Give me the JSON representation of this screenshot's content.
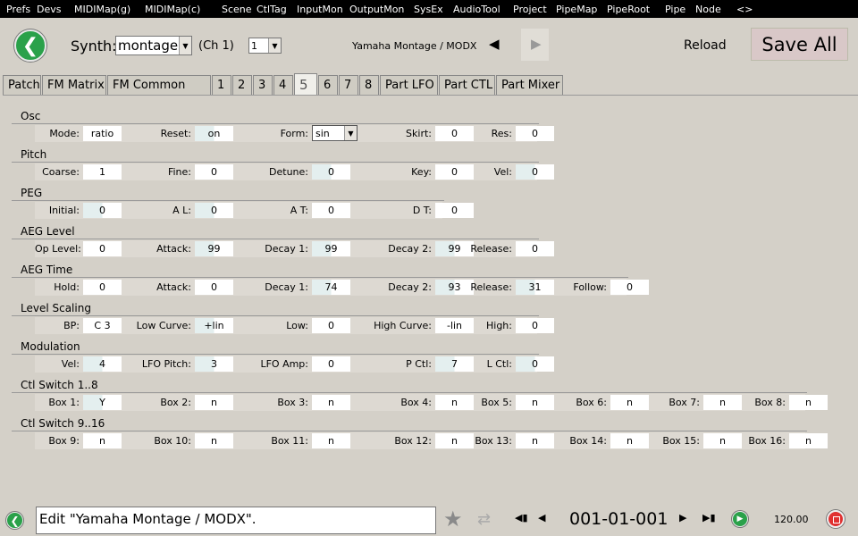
{
  "menu": [
    "Prefs",
    "Devs",
    "MIDIMap(g)",
    "MIDIMap(c)",
    "Scene",
    "CtlTag",
    "InputMon",
    "OutputMon",
    "SysEx",
    "AudioTool",
    "Project",
    "PipeMap",
    "PipeRoot",
    "Pipe",
    "Node",
    "<>"
  ],
  "header": {
    "synth_label": "Synth:",
    "synth_value": "montage",
    "ch_label": "(Ch 1)",
    "ch_value": "1",
    "device_title": "Yamaha Montage / MODX",
    "reload": "Reload",
    "save_all": "Save All"
  },
  "tabs": [
    {
      "label": "Patch",
      "active": false
    },
    {
      "label": "FM Matrix",
      "active": false
    },
    {
      "label": "FM Common",
      "active": false
    },
    {
      "label": "1",
      "active": false
    },
    {
      "label": "2",
      "active": false
    },
    {
      "label": "3",
      "active": false
    },
    {
      "label": "4",
      "active": false
    },
    {
      "label": "5",
      "active": true
    },
    {
      "label": "6",
      "active": false
    },
    {
      "label": "7",
      "active": false
    },
    {
      "label": "8",
      "active": false
    },
    {
      "label": "Part LFO",
      "active": false
    },
    {
      "label": "Part CTL",
      "active": false
    },
    {
      "label": "Part Mixer",
      "active": false
    }
  ],
  "sections": [
    {
      "title": "Osc",
      "fields": [
        {
          "label": "Mode:",
          "value": "ratio"
        },
        {
          "label": "Reset:",
          "value": "on",
          "style": "teal"
        },
        {
          "label": "Form:",
          "value": "sin",
          "type": "select"
        },
        {
          "label": "Skirt:",
          "value": "0"
        },
        {
          "label": "Res:",
          "value": "0"
        }
      ]
    },
    {
      "title": "Pitch",
      "fields": [
        {
          "label": "Coarse:",
          "value": "1"
        },
        {
          "label": "Fine:",
          "value": "0"
        },
        {
          "label": "Detune:",
          "value": "0",
          "style": "teal"
        },
        {
          "label": "Key:",
          "value": "0"
        },
        {
          "label": "Vel:",
          "value": "0",
          "style": "teal"
        }
      ]
    },
    {
      "title": "PEG",
      "fields": [
        {
          "label": "Initial:",
          "value": "0",
          "style": "teal"
        },
        {
          "label": "A L:",
          "value": "0",
          "style": "teal"
        },
        {
          "label": "A T:",
          "value": "0"
        },
        {
          "label": "D T:",
          "value": "0"
        }
      ]
    },
    {
      "title": "AEG Level",
      "fields": [
        {
          "label": "Op Level:",
          "value": "0"
        },
        {
          "label": "Attack:",
          "value": "99",
          "style": "teal"
        },
        {
          "label": "Decay 1:",
          "value": "99",
          "style": "teal"
        },
        {
          "label": "Decay 2:",
          "value": "99",
          "style": "teal"
        },
        {
          "label": "Release:",
          "value": "0"
        }
      ]
    },
    {
      "title": "AEG Time",
      "fields": [
        {
          "label": "Hold:",
          "value": "0"
        },
        {
          "label": "Attack:",
          "value": "0"
        },
        {
          "label": "Decay 1:",
          "value": "74",
          "style": "teal"
        },
        {
          "label": "Decay 2:",
          "value": "93",
          "style": "teal"
        },
        {
          "label": "Release:",
          "value": "31",
          "style": "teal"
        },
        {
          "label": "Follow:",
          "value": "0"
        }
      ]
    },
    {
      "title": "Level Scaling",
      "fields": [
        {
          "label": "BP:",
          "value": "C 3"
        },
        {
          "label": "Low Curve:",
          "value": "+lin",
          "style": "teal"
        },
        {
          "label": "Low:",
          "value": "0"
        },
        {
          "label": "High Curve:",
          "value": "-lin"
        },
        {
          "label": "High:",
          "value": "0"
        }
      ]
    },
    {
      "title": "Modulation",
      "fields": [
        {
          "label": "Vel:",
          "value": "4",
          "style": "teal"
        },
        {
          "label": "LFO Pitch:",
          "value": "3",
          "style": "teal"
        },
        {
          "label": "LFO Amp:",
          "value": "0"
        },
        {
          "label": "P Ctl:",
          "value": "7",
          "style": "teal"
        },
        {
          "label": "L Ctl:",
          "value": "0",
          "style": "teal"
        }
      ]
    },
    {
      "title": "Ctl Switch 1..8",
      "fields": [
        {
          "label": "Box 1:",
          "value": "Y",
          "style": "teal"
        },
        {
          "label": "Box 2:",
          "value": "n"
        },
        {
          "label": "Box 3:",
          "value": "n"
        },
        {
          "label": "Box 4:",
          "value": "n"
        },
        {
          "label": "Box 5:",
          "value": "n"
        },
        {
          "label": "Box 6:",
          "value": "n"
        },
        {
          "label": "Box 7:",
          "value": "n"
        },
        {
          "label": "Box 8:",
          "value": "n"
        }
      ]
    },
    {
      "title": "Ctl Switch 9..16",
      "fields": [
        {
          "label": "Box 9:",
          "value": "n"
        },
        {
          "label": "Box 10:",
          "value": "n"
        },
        {
          "label": "Box 11:",
          "value": "n"
        },
        {
          "label": "Box 12:",
          "value": "n"
        },
        {
          "label": "Box 13:",
          "value": "n"
        },
        {
          "label": "Box 14:",
          "value": "n"
        },
        {
          "label": "Box 15:",
          "value": "n"
        },
        {
          "label": "Box 16:",
          "value": "n"
        }
      ]
    }
  ],
  "status": {
    "message": "Edit \"Yamaha Montage / MODX\".",
    "position": "001-01-001",
    "tempo": "120.00"
  },
  "icons": {
    "back": "arrow-left-icon",
    "prev": "triangle-left-icon",
    "next": "triangle-right-icon",
    "star": "star-icon",
    "shuffle": "shuffle-icon",
    "first": "skip-first-icon",
    "last": "skip-last-icon",
    "play": "play-icon",
    "stop": "stop-icon"
  },
  "colors": {
    "accent_green": "#2aa14a",
    "stop_red": "#e03030",
    "save_bg": "#d9c8c8"
  }
}
